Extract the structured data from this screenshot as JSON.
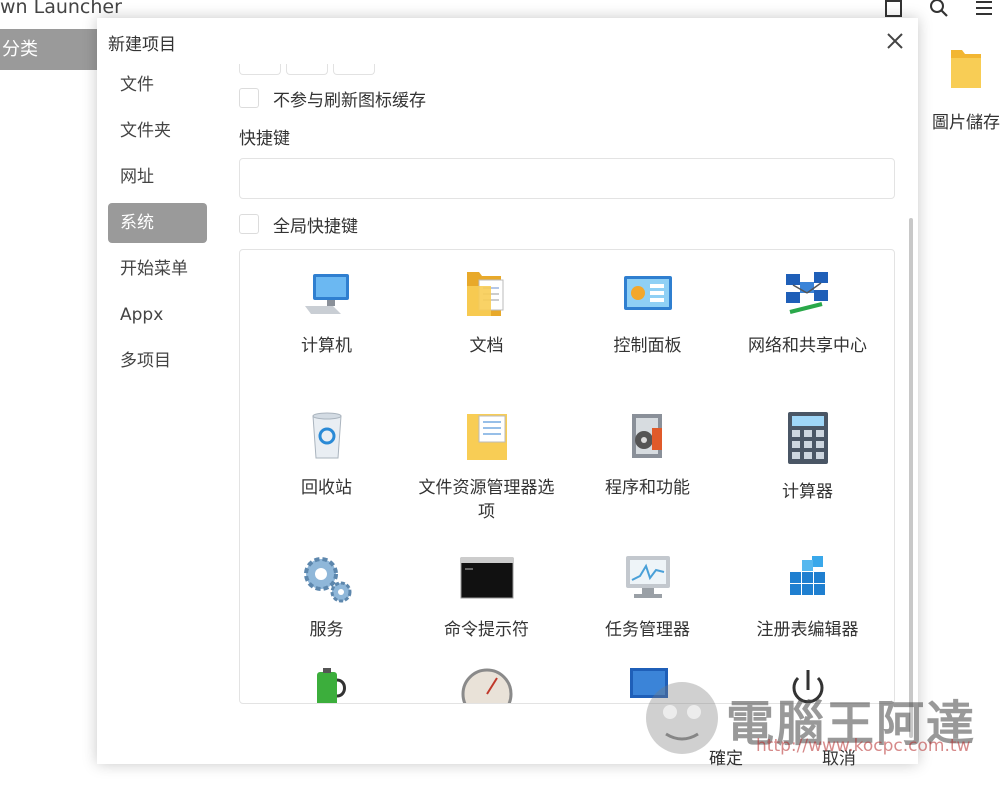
{
  "app": {
    "title": "wn Launcher",
    "category_label": "分类",
    "desktop_item_label": "圖片儲存"
  },
  "dialog": {
    "title": "新建项目",
    "nav": [
      "文件",
      "文件夹",
      "网址",
      "系统",
      "开始菜单",
      "Appx",
      "多项目"
    ],
    "active_nav_index": 3,
    "no_refresh_label": "不参与刷新图标缓存",
    "hotkey_label": "快捷键",
    "hotkey_value": "",
    "global_hotkey_label": "全局快捷键",
    "items": [
      {
        "label": "计算机",
        "icon": "computer-icon"
      },
      {
        "label": "文档",
        "icon": "documents-icon"
      },
      {
        "label": "控制面板",
        "icon": "control-panel-icon"
      },
      {
        "label": "网络和共享中心",
        "icon": "network-center-icon"
      },
      {
        "label": "回收站",
        "icon": "recycle-bin-icon"
      },
      {
        "label": "文件资源管理器选项",
        "icon": "folder-options-icon"
      },
      {
        "label": "程序和功能",
        "icon": "programs-features-icon"
      },
      {
        "label": "计算器",
        "icon": "calculator-icon"
      },
      {
        "label": "服务",
        "icon": "services-icon"
      },
      {
        "label": "命令提示符",
        "icon": "command-prompt-icon"
      },
      {
        "label": "任务管理器",
        "icon": "task-manager-icon"
      },
      {
        "label": "注册表编辑器",
        "icon": "registry-editor-icon"
      }
    ],
    "ok_label": "確定",
    "cancel_label": "取消"
  },
  "watermark": {
    "text": "電腦王阿達",
    "url": "http://www.kocpc.com.tw"
  },
  "colors": {
    "active_nav": "#9a9a9a",
    "border": "#e3e3e3",
    "folder_yellow": "#f5c542"
  }
}
